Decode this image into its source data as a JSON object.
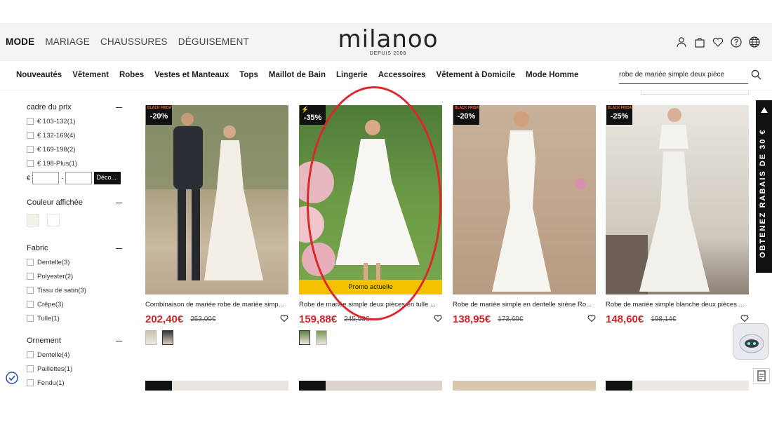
{
  "top_nav": {
    "items": [
      "MODE",
      "MARIAGE",
      "CHAUSSURES",
      "DÉGUISEMENT"
    ]
  },
  "logo": {
    "word": "milanoo",
    "since": "DEPUIS 2008"
  },
  "icons": [
    "user-icon",
    "bag-icon",
    "heart-icon",
    "help-icon",
    "globe-icon"
  ],
  "categories": [
    "Nouveautés",
    "Vêtement",
    "Robes",
    "Vestes et Manteaux",
    "Tops",
    "Maillot de Bain",
    "Lingerie",
    "Accessoires",
    "Vêtement à Domicile",
    "Mode Homme"
  ],
  "search": {
    "value": "robe de mariée simple deux pièce"
  },
  "filters": {
    "price": {
      "title": "cadre du prix",
      "options": [
        "€ 103-132(1)",
        "€ 132-169(4)",
        "€ 169-198(2)",
        "€ 198-Plus(1)"
      ],
      "currency": "€",
      "dash": "-",
      "button": "Déco..."
    },
    "color": {
      "title": "Couleur affichée",
      "swatches": [
        "#f1f3e8",
        "#ffffff"
      ]
    },
    "fabric": {
      "title": "Fabric",
      "options": [
        "Dentelle(3)",
        "Polyester(2)",
        "Tissu de satin(3)",
        "Crêpe(3)",
        "Tulle(1)"
      ]
    },
    "ornament": {
      "title": "Ornement",
      "options": [
        "Dentelle(4)",
        "Paillettes(1)",
        "Fendu(1)"
      ]
    }
  },
  "products": [
    {
      "badge_top": "BLACK FRIDAY",
      "discount": "-20%",
      "title": "Combinaison de mariée robe de mariée simp...",
      "price": "202,40€",
      "old_price": "253,00€"
    },
    {
      "badge_top": "⚡",
      "discount": "-35%",
      "promo": "Promo actuelle",
      "title": "Robe de mariée simple deux pièces en tulle ...",
      "price": "159,88€",
      "old_price": "245,98€"
    },
    {
      "badge_top": "BLACK FRIDAY",
      "discount": "-20%",
      "title": "Robe de mariée simple en dentelle sirène Ro...",
      "price": "138,95€",
      "old_price": "173,69€"
    },
    {
      "badge_top": "BLACK FRIDAY",
      "discount": "-25%",
      "title": "Robe de mariée simple blanche deux pièces ...",
      "price": "148,60€",
      "old_price": "198,14€"
    }
  ],
  "side_tab": {
    "text": "OBTENEZ RABAIS DE 30 €"
  },
  "colors": {
    "accent": "#d2232a",
    "promo": "#f2c200",
    "highlight_circle": "#e0262b"
  }
}
